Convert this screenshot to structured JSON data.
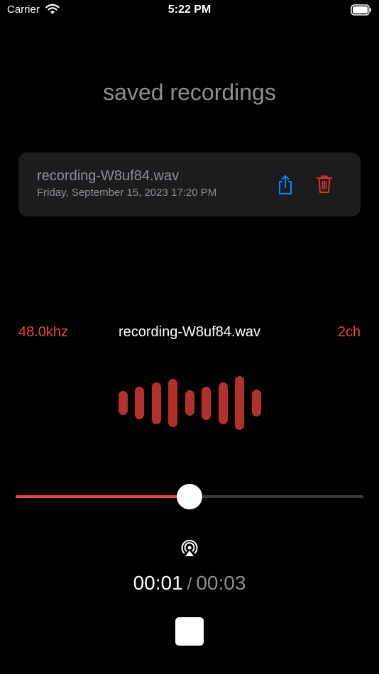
{
  "status_bar": {
    "carrier": "Carrier",
    "time": "5:22 PM",
    "wifi_icon": "wifi-icon",
    "battery_icon": "battery-icon"
  },
  "heading": "saved recordings",
  "recordings": [
    {
      "name": "recording-W8uf84.wav",
      "date": "Friday, September 15, 2023 17:20 PM",
      "share_icon": "share-icon",
      "delete_icon": "trash-icon"
    }
  ],
  "player": {
    "sample_rate": "48.0khz",
    "file_name": "recording-W8uf84.wav",
    "channels": "2ch",
    "waveform_levels": [
      0.45,
      0.6,
      0.78,
      0.9,
      0.48,
      0.62,
      0.78,
      1.0,
      0.5
    ],
    "progress": 0.5,
    "airplay_icon": "airplay-icon",
    "elapsed": "00:01",
    "separator": "/",
    "duration": "00:03",
    "stop_icon": "stop-icon"
  },
  "colors": {
    "accent": "#e8473f",
    "waveform": "#b3302c",
    "share": "#0a84ff",
    "delete": "#d9342b",
    "secondary_text": "#8e8e93",
    "card": "#1c1c1e"
  }
}
